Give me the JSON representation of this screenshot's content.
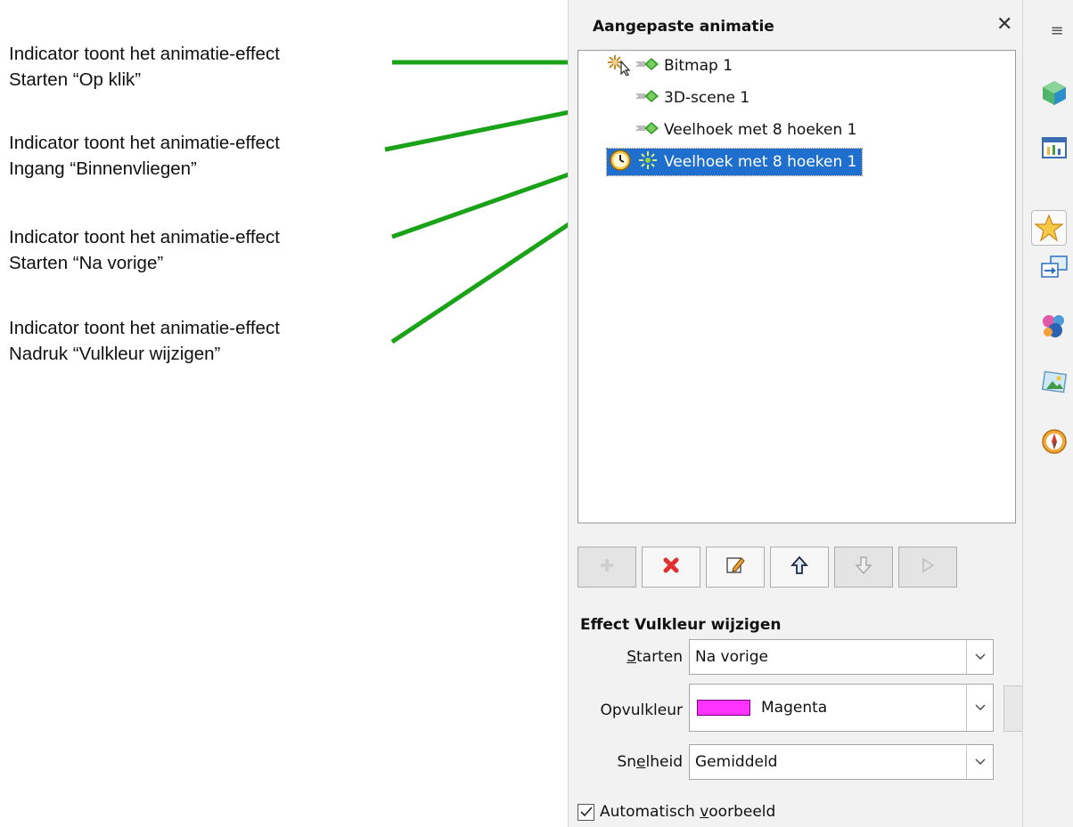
{
  "callouts": [
    {
      "line1": "Indicator toont het animatie-effect",
      "line2": "Starten “Op klik”"
    },
    {
      "line1": "Indicator toont het animatie-effect",
      "line2": "Ingang “Binnenvliegen”"
    },
    {
      "line1": "Indicator toont het animatie-effect",
      "line2": "Starten “Na vorige”"
    },
    {
      "line1": "Indicator toont het animatie-effect",
      "line2": "Nadruk “Vulkleur wijzigen”"
    }
  ],
  "panel": {
    "title": "Aangepaste animatie",
    "close_symbol": "✕",
    "list_items": [
      {
        "label": "Bitmap 1",
        "start_icon": "on-click-icon",
        "effect_icon": "entrance-fly-in-icon",
        "selected": false
      },
      {
        "label": "3D-scene 1",
        "start_icon": "",
        "effect_icon": "entrance-fly-in-icon",
        "selected": false
      },
      {
        "label": "Veelhoek met 8 hoeken 1",
        "start_icon": "",
        "effect_icon": "entrance-fly-in-icon",
        "selected": false
      },
      {
        "label": "Veelhoek met 8 hoeken 1",
        "start_icon": "after-previous-clock-icon",
        "effect_icon": "emphasis-fill-color-icon",
        "selected": true
      }
    ],
    "toolbar": [
      "add-effect-icon",
      "remove-effect-icon",
      "change-effect-icon",
      "move-up-icon",
      "move-down-icon",
      "play-icon"
    ],
    "effect_heading": "Effect Vulkleur wijzigen",
    "start": {
      "label_pre": "",
      "label_ul": "S",
      "label_post": "tarten",
      "value": "Na vorige"
    },
    "fill": {
      "label": "Opvulkleur",
      "value": "Magenta",
      "swatch_color": "#ff33ff"
    },
    "speed": {
      "label_pre": "Sn",
      "label_ul": "e",
      "label_post": "lheid",
      "value": "Gemiddeld"
    },
    "autopreview": {
      "label_pre": "Automatisch ",
      "label_ul": "v",
      "label_post": "oorbeeld",
      "checked": true
    }
  },
  "tabbar": {
    "menu_icon": "≡",
    "icons": [
      "3d-cube-icon",
      "slide-layout-icon",
      "custom-animation-star-icon",
      "slide-transition-icon",
      "styles-icon",
      "gallery-icon",
      "navigator-compass-icon"
    ],
    "active_index": 2
  },
  "colors": {
    "arrow": "#1aa319",
    "selection": "#1f6fcf",
    "magenta": "#ff33ff"
  }
}
